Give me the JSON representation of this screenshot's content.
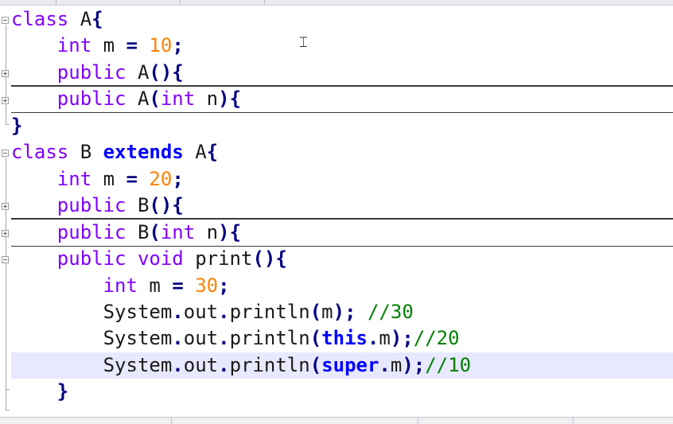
{
  "editor": {
    "language": "Java",
    "cursor_icon": "text-cursor-ibeam-icon",
    "lines": [
      {
        "tokens": [
          {
            "t": "class",
            "c": "type"
          },
          {
            "t": " A",
            "c": "id"
          },
          {
            "t": "{",
            "c": "op"
          }
        ]
      },
      {
        "tokens": [
          {
            "t": "    ",
            "c": "id"
          },
          {
            "t": "int",
            "c": "type"
          },
          {
            "t": " m ",
            "c": "id"
          },
          {
            "t": "=",
            "c": "op"
          },
          {
            "t": " ",
            "c": "id"
          },
          {
            "t": "10",
            "c": "num"
          },
          {
            "t": ";",
            "c": "op"
          }
        ]
      },
      {
        "tokens": [
          {
            "t": "    ",
            "c": "id"
          },
          {
            "t": "public",
            "c": "type"
          },
          {
            "t": " A",
            "c": "id"
          },
          {
            "t": "(){",
            "c": "op"
          }
        ]
      },
      {
        "tokens": [
          {
            "t": "    ",
            "c": "id"
          },
          {
            "t": "public",
            "c": "type"
          },
          {
            "t": " A",
            "c": "id"
          },
          {
            "t": "(",
            "c": "op"
          },
          {
            "t": "int",
            "c": "type"
          },
          {
            "t": " n",
            "c": "id"
          },
          {
            "t": "){",
            "c": "op"
          }
        ]
      },
      {
        "tokens": [
          {
            "t": "}",
            "c": "op"
          }
        ]
      },
      {
        "tokens": [
          {
            "t": "class",
            "c": "type"
          },
          {
            "t": " B ",
            "c": "id"
          },
          {
            "t": "extends",
            "c": "bold"
          },
          {
            "t": " A",
            "c": "id"
          },
          {
            "t": "{",
            "c": "op"
          }
        ]
      },
      {
        "tokens": [
          {
            "t": "    ",
            "c": "id"
          },
          {
            "t": "int",
            "c": "type"
          },
          {
            "t": " m ",
            "c": "id"
          },
          {
            "t": "=",
            "c": "op"
          },
          {
            "t": " ",
            "c": "id"
          },
          {
            "t": "20",
            "c": "num"
          },
          {
            "t": ";",
            "c": "op"
          }
        ]
      },
      {
        "tokens": [
          {
            "t": "    ",
            "c": "id"
          },
          {
            "t": "public",
            "c": "type"
          },
          {
            "t": " B",
            "c": "id"
          },
          {
            "t": "(){",
            "c": "op"
          }
        ]
      },
      {
        "tokens": [
          {
            "t": "    ",
            "c": "id"
          },
          {
            "t": "public",
            "c": "type"
          },
          {
            "t": " B",
            "c": "id"
          },
          {
            "t": "(",
            "c": "op"
          },
          {
            "t": "int",
            "c": "type"
          },
          {
            "t": " n",
            "c": "id"
          },
          {
            "t": "){",
            "c": "op"
          }
        ]
      },
      {
        "tokens": [
          {
            "t": "    ",
            "c": "id"
          },
          {
            "t": "public",
            "c": "type"
          },
          {
            "t": " ",
            "c": "id"
          },
          {
            "t": "void",
            "c": "type"
          },
          {
            "t": " print",
            "c": "id"
          },
          {
            "t": "(){",
            "c": "op"
          }
        ]
      },
      {
        "tokens": [
          {
            "t": "        ",
            "c": "id"
          },
          {
            "t": "int",
            "c": "type"
          },
          {
            "t": " m ",
            "c": "id"
          },
          {
            "t": "=",
            "c": "op"
          },
          {
            "t": " ",
            "c": "id"
          },
          {
            "t": "30",
            "c": "num"
          },
          {
            "t": ";",
            "c": "op"
          }
        ]
      },
      {
        "tokens": [
          {
            "t": "        System",
            "c": "id"
          },
          {
            "t": ".",
            "c": "op"
          },
          {
            "t": "out",
            "c": "id"
          },
          {
            "t": ".",
            "c": "op"
          },
          {
            "t": "println",
            "c": "id"
          },
          {
            "t": "(",
            "c": "op"
          },
          {
            "t": "m",
            "c": "id"
          },
          {
            "t": ");",
            "c": "op"
          },
          {
            "t": " ",
            "c": "id"
          },
          {
            "t": "//30",
            "c": "cmt"
          }
        ]
      },
      {
        "tokens": [
          {
            "t": "        System",
            "c": "id"
          },
          {
            "t": ".",
            "c": "op"
          },
          {
            "t": "out",
            "c": "id"
          },
          {
            "t": ".",
            "c": "op"
          },
          {
            "t": "println",
            "c": "id"
          },
          {
            "t": "(",
            "c": "op"
          },
          {
            "t": "this",
            "c": "bold"
          },
          {
            "t": ".",
            "c": "op"
          },
          {
            "t": "m",
            "c": "id"
          },
          {
            "t": ");",
            "c": "op"
          },
          {
            "t": "//20",
            "c": "cmt"
          }
        ]
      },
      {
        "tokens": [
          {
            "t": "        System",
            "c": "id"
          },
          {
            "t": ".",
            "c": "op"
          },
          {
            "t": "out",
            "c": "id"
          },
          {
            "t": ".",
            "c": "op"
          },
          {
            "t": "println",
            "c": "id"
          },
          {
            "t": "(",
            "c": "op"
          },
          {
            "t": "super",
            "c": "bold"
          },
          {
            "t": ".",
            "c": "op"
          },
          {
            "t": "m",
            "c": "id"
          },
          {
            "t": ");",
            "c": "op"
          },
          {
            "t": "//10",
            "c": "cmt"
          }
        ]
      },
      {
        "tokens": [
          {
            "t": "    ",
            "c": "id"
          },
          {
            "t": "}",
            "c": "op"
          }
        ]
      }
    ]
  }
}
